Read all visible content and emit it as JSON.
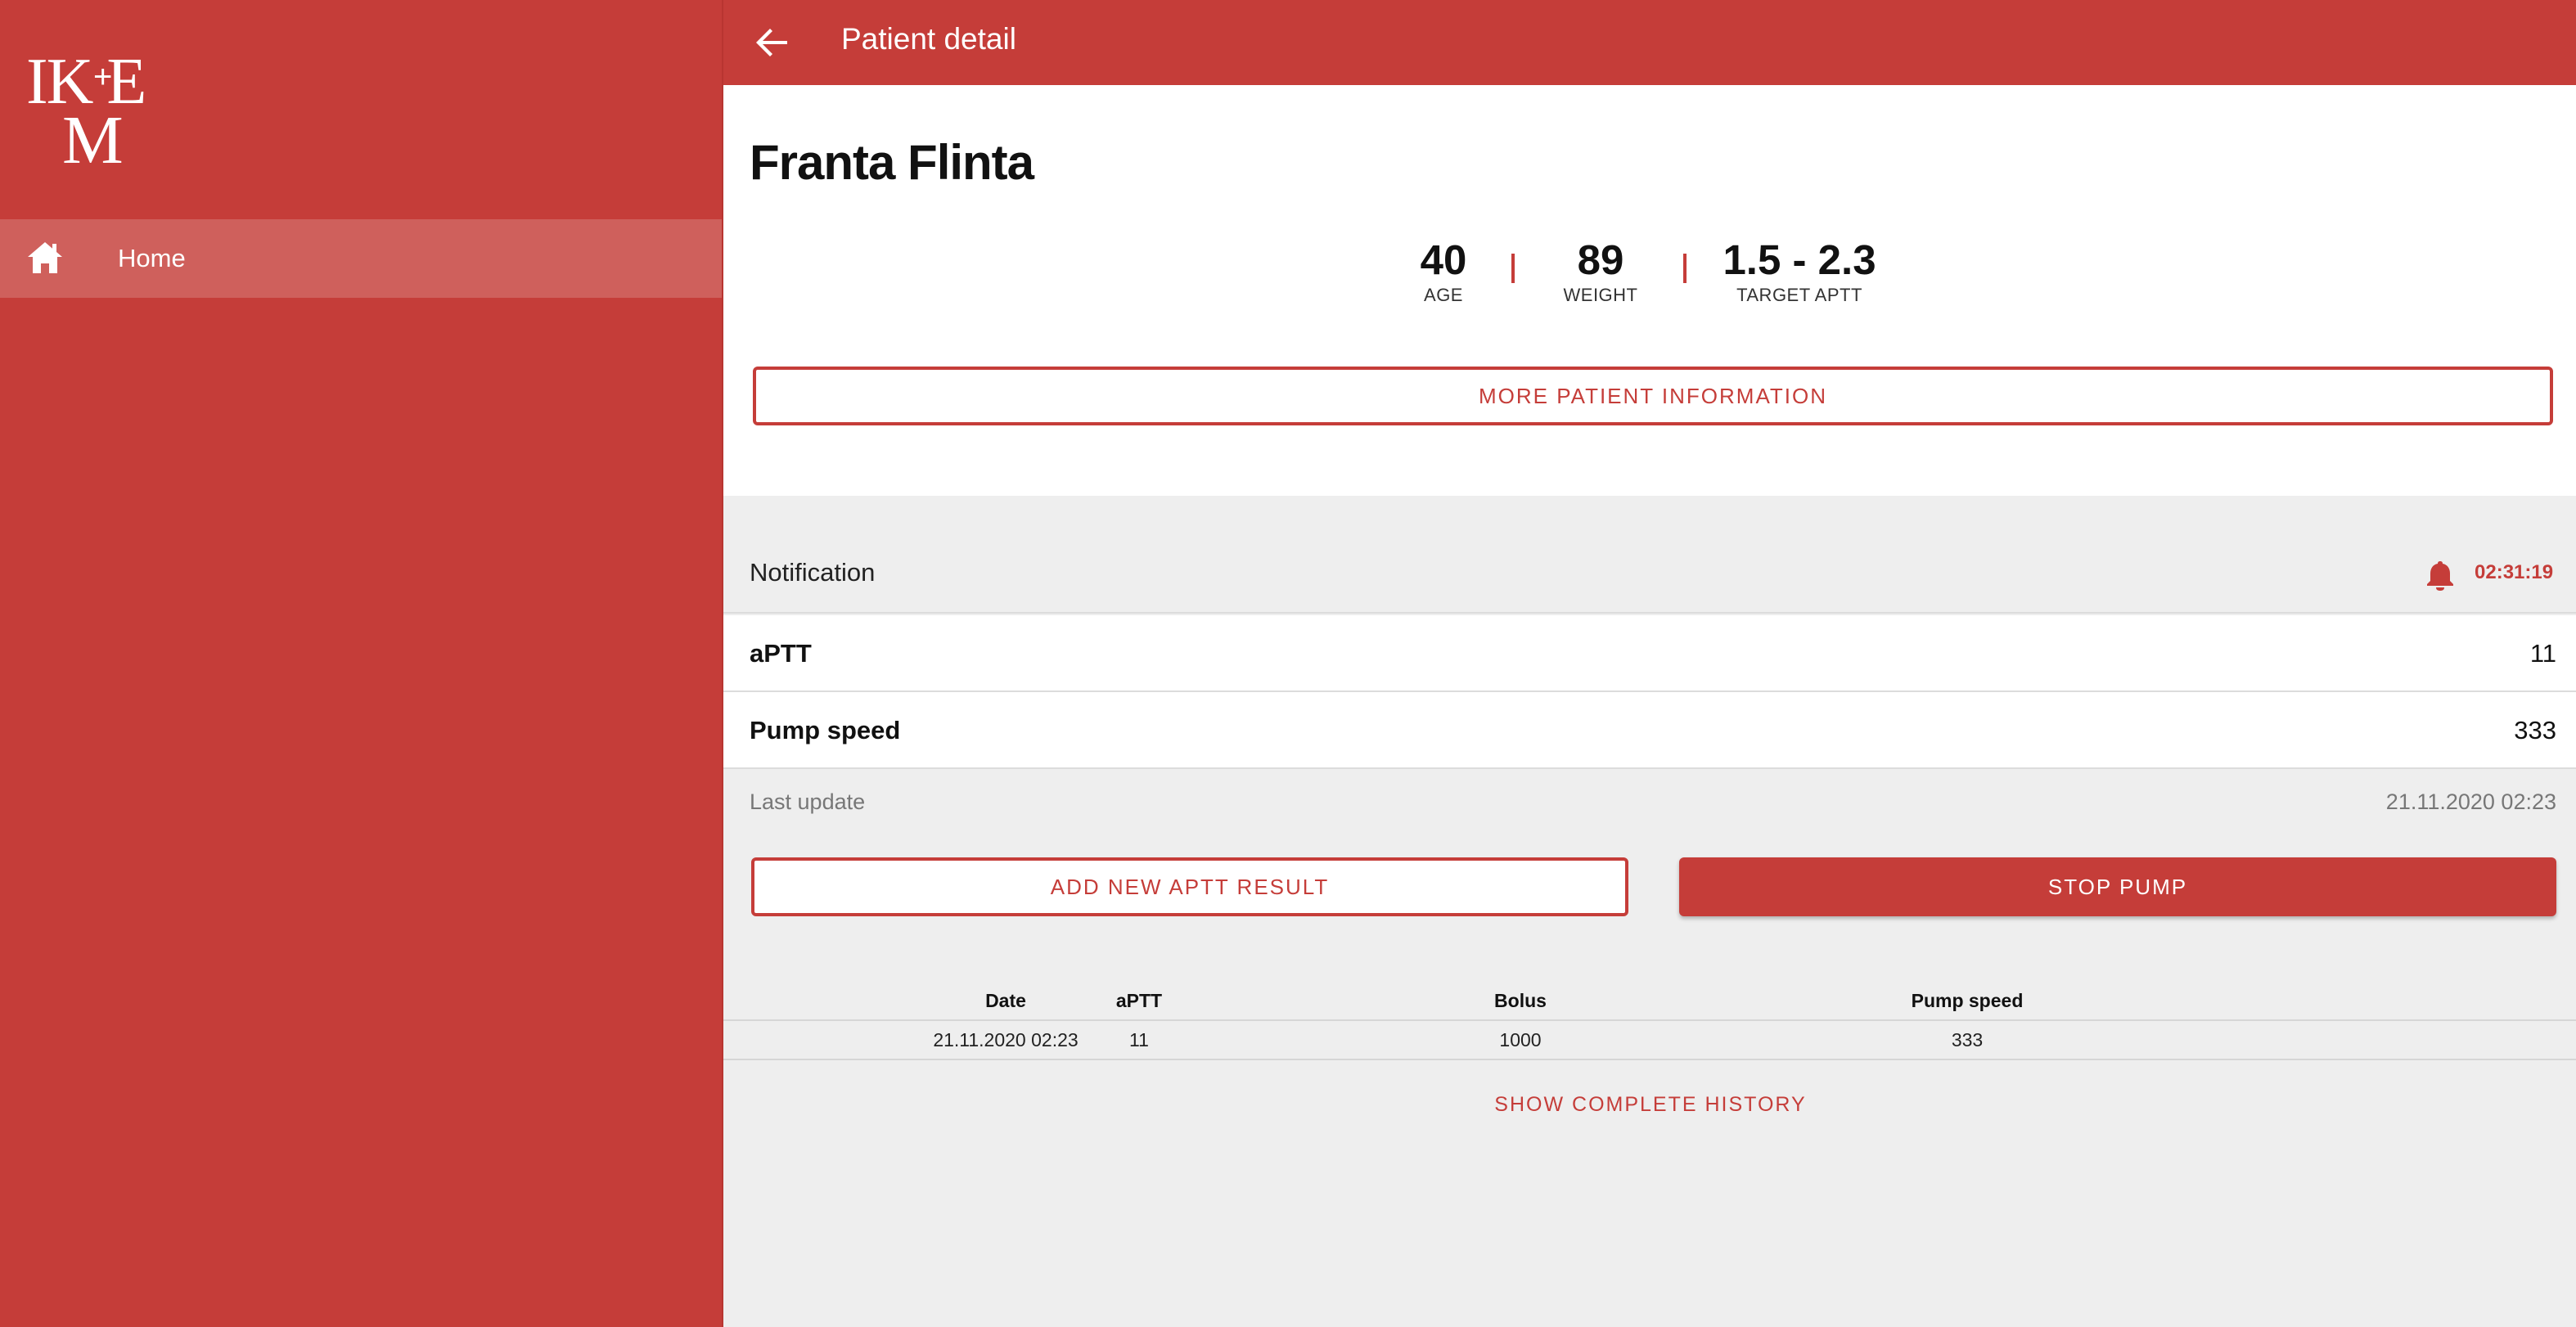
{
  "sidebar": {
    "logo": "IKEM",
    "items": [
      {
        "label": "Home",
        "icon": "home-icon"
      }
    ]
  },
  "header": {
    "title": "Patient detail",
    "back_icon": "arrow-left-icon"
  },
  "patient": {
    "name": "Franta Flinta",
    "stats": [
      {
        "value": "40",
        "label": "AGE"
      },
      {
        "value": "89",
        "label": "WEIGHT"
      },
      {
        "value": "1.5 - 2.3",
        "label": "TARGET APTT"
      }
    ],
    "more_button": "MORE PATIENT INFORMATION"
  },
  "notification": {
    "label": "Notification",
    "icon": "bell-icon",
    "time": "02:31:19"
  },
  "measurements": [
    {
      "label": "aPTT",
      "value": "11"
    },
    {
      "label": "Pump speed",
      "value": "333"
    }
  ],
  "last_update": {
    "label": "Last update",
    "value": "21.11.2020 02:23"
  },
  "actions": {
    "add_label": "ADD NEW APTT RESULT",
    "stop_label": "STOP PUMP"
  },
  "history": {
    "columns": [
      "Date",
      "aPTT",
      "Bolus",
      "Pump speed"
    ],
    "rows": [
      [
        "21.11.2020 02:23",
        "11",
        "1000",
        "333"
      ]
    ],
    "link_label": "SHOW COMPLETE HISTORY"
  },
  "colors": {
    "primary": "#c53d39",
    "background": "#eeeeee",
    "surface": "#ffffff"
  }
}
